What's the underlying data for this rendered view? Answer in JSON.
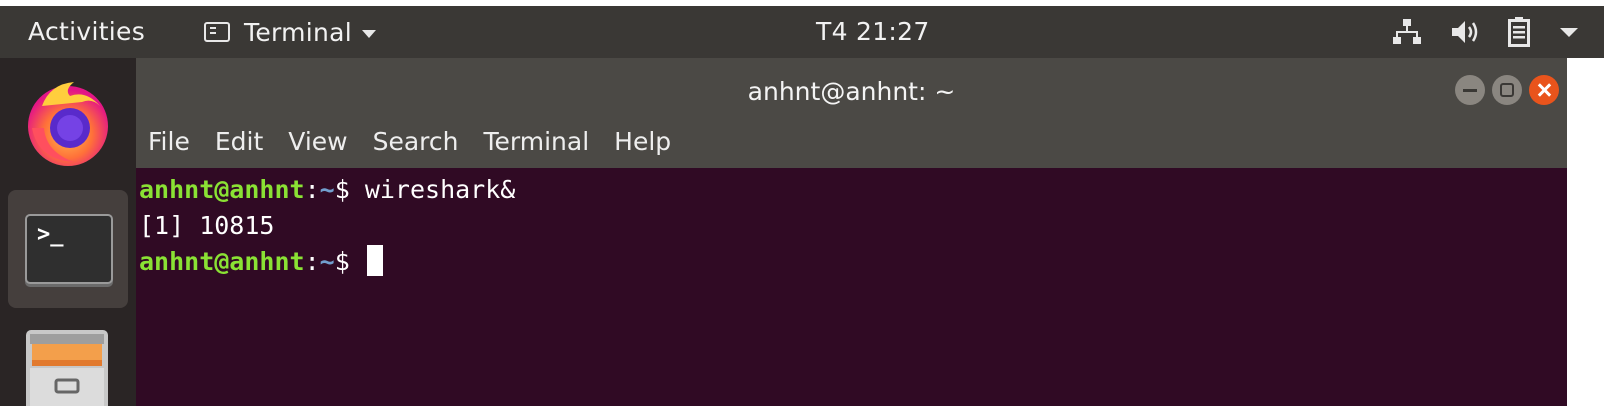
{
  "topbar": {
    "activities_label": "Activities",
    "app_menu_label": "Terminal",
    "clock": "T4 21:27",
    "tray_icons": [
      "network-icon",
      "volume-icon",
      "battery-icon",
      "system-menu-chevron-icon"
    ]
  },
  "dock": {
    "items": [
      {
        "name": "firefox",
        "icon": "firefox-icon"
      },
      {
        "name": "terminal",
        "icon": "terminal-icon",
        "running": true,
        "prompt_glyph": ">_"
      },
      {
        "name": "files",
        "icon": "files-icon"
      }
    ],
    "running_indicator_color": "#e9541c"
  },
  "window": {
    "title": "anhnt@anhnt: ~",
    "menu": [
      "File",
      "Edit",
      "View",
      "Search",
      "Terminal",
      "Help"
    ]
  },
  "terminal": {
    "lines": [
      {
        "user": "anhnt@anhnt",
        "sep": ":",
        "path": "~",
        "dollar": "$ ",
        "command": "wireshark&"
      },
      {
        "output": "[1] 10815"
      },
      {
        "user": "anhnt@anhnt",
        "sep": ":",
        "path": "~",
        "dollar": "$ ",
        "command": ""
      }
    ],
    "colors": {
      "background": "#300a24",
      "user": "#8ae234",
      "path": "#729fcf",
      "text": "#ffffff"
    }
  }
}
